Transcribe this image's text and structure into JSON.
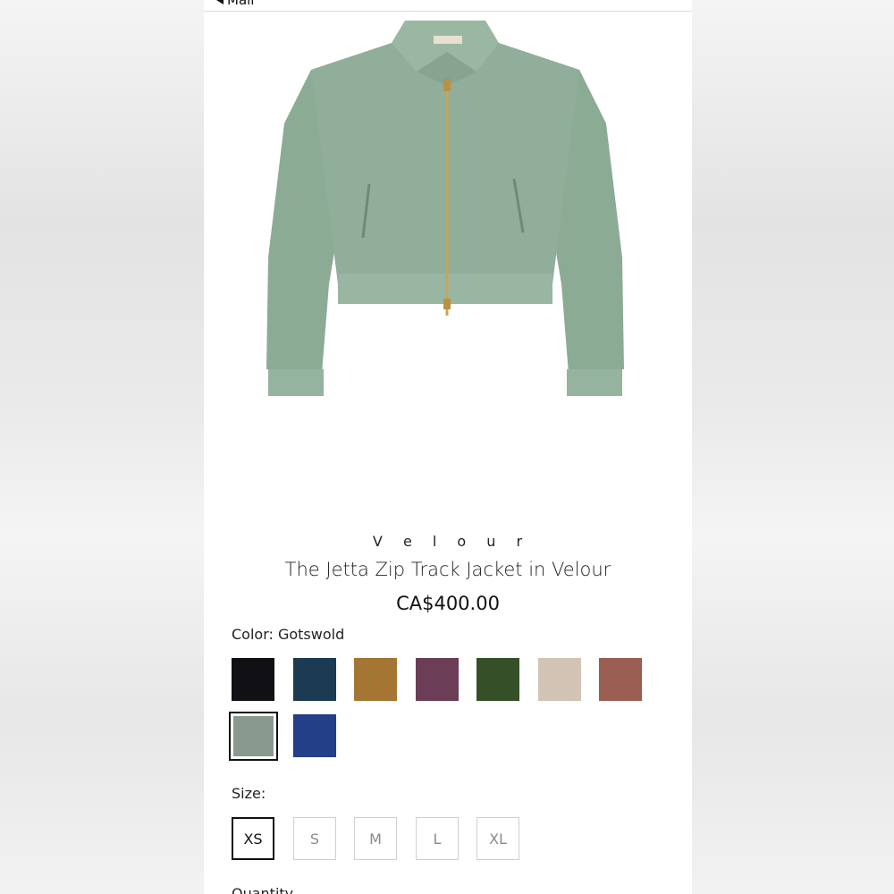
{
  "nav": {
    "back_label": "Mail"
  },
  "product": {
    "brand": "V e l o u r",
    "title": "The Jetta Zip Track Jacket in Velour",
    "price": "CA$400.00",
    "image_icon": "green-velour-zip-jacket",
    "jacket_color": "#8fae98"
  },
  "color": {
    "label": "Color: Gotswold",
    "swatches": [
      {
        "color": "#111015",
        "selected": false
      },
      {
        "color": "#1c3a52",
        "selected": false
      },
      {
        "color": "#a57534",
        "selected": false
      },
      {
        "color": "#6c3d56",
        "selected": false
      },
      {
        "color": "#355029",
        "selected": false
      },
      {
        "color": "#d3c3b5",
        "selected": false
      },
      {
        "color": "#9a5e52",
        "selected": false
      },
      {
        "color": "#8a998e",
        "selected": true
      },
      {
        "color": "#223f88",
        "selected": false
      }
    ]
  },
  "size": {
    "label": "Size:",
    "options": [
      {
        "label": "XS",
        "selected": true
      },
      {
        "label": "S",
        "selected": false
      },
      {
        "label": "M",
        "selected": false
      },
      {
        "label": "L",
        "selected": false
      },
      {
        "label": "XL",
        "selected": false
      }
    ]
  },
  "quantity": {
    "label": "Quantity"
  }
}
